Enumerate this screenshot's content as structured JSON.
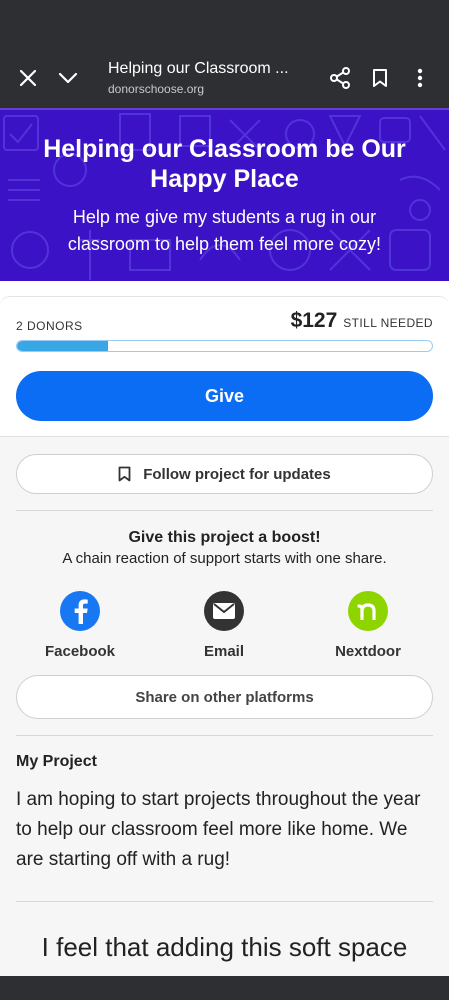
{
  "browser": {
    "title": "Helping our Classroom ...",
    "url": "donorschoose.org"
  },
  "hero": {
    "title": "Helping our Classroom be Our Happy Place",
    "subtitle": "Help me give my students a rug in our classroom to help them feel more cozy!",
    "bg_color": "#3b12c6"
  },
  "funding": {
    "donors_label": "2 DONORS",
    "amount_needed": "$127",
    "still_needed_label": "STILL NEEDED",
    "progress_fraction": 0.22,
    "give_label": "Give"
  },
  "follow": {
    "label": "Follow project for updates",
    "icon": "bookmark-icon"
  },
  "boost": {
    "title": "Give this project a boost!",
    "subtitle": "A chain reaction of support starts with one share.",
    "facebook_label": "Facebook",
    "email_label": "Email",
    "nextdoor_label": "Nextdoor",
    "other_label": "Share on other platforms"
  },
  "project": {
    "heading": "My Project",
    "body": "I am hoping to start projects throughout the year to help our classroom feel more like home. We are starting off with a rug!",
    "essay_start": "I feel that adding this soft space"
  },
  "colors": {
    "give_blue": "#0b6cf4",
    "facebook_blue": "#1877f2",
    "nextdoor_green": "#8ed500",
    "email_dark": "#333333"
  }
}
